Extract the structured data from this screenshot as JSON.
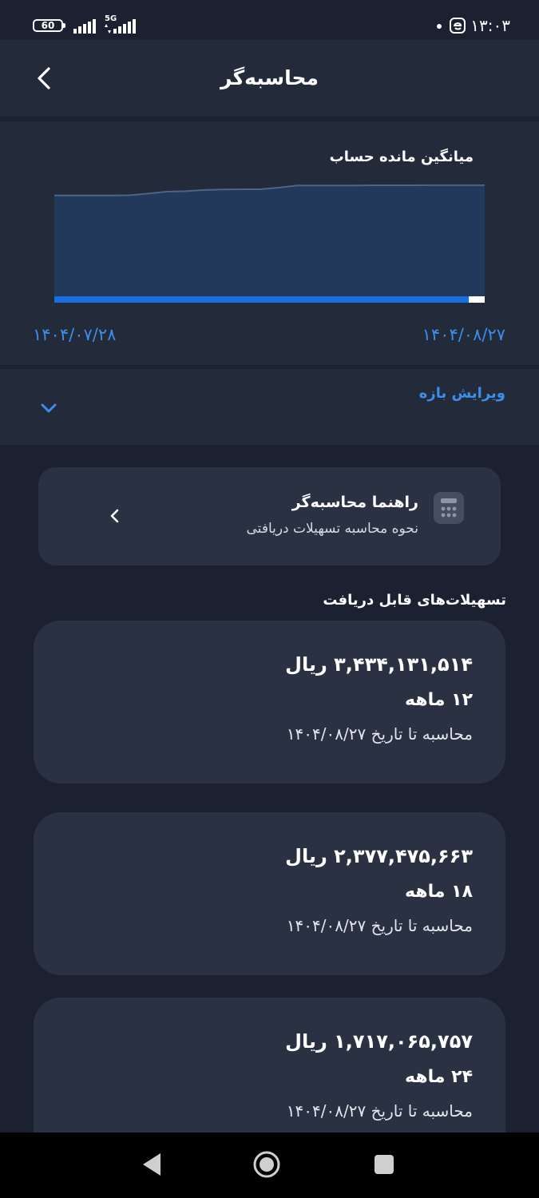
{
  "status_bar": {
    "battery": "60",
    "network": "5G",
    "time": "۱۳:۰۳"
  },
  "header": {
    "title": "محاسبه‌گر",
    "back_icon": "chevron-left-icon"
  },
  "balance_chart": {
    "title": "میانگین مانده حساب",
    "date_start": "۱۴۰۴/۰۷/۲۸",
    "date_end": "۱۴۰۴/۰۸/۲۷",
    "fill_color": "#23395b",
    "line_color": "#4f6384",
    "bar_color": "#1a6fe0",
    "progress_fraction": 0.963
  },
  "chart_data": {
    "type": "area",
    "title": "میانگین مانده حساب",
    "x_start": "۱۴۰۴/۰۷/۲۸",
    "x_end": "۱۴۰۴/۰۸/۲۷",
    "y_axis_labels": "none",
    "relative_values": [
      0.848,
      0.848,
      0.848,
      0.849,
      0.85,
      0.864,
      0.88,
      0.884,
      0.894,
      0.899,
      0.9,
      0.9,
      0.914,
      0.932,
      0.932,
      0.932,
      0.932,
      0.933,
      0.933,
      0.933,
      0.934,
      0.934,
      0.934,
      0.934
    ]
  },
  "range": {
    "label": "ویرایش بازه",
    "icon": "chevron-down-icon"
  },
  "guide": {
    "title": "راهنما محاسبه‌گر",
    "subtitle": "نحوه محاسبه تسهیلات دریافتی",
    "icon": "calculator-icon",
    "chevron": "chevron-left-icon"
  },
  "facilities": {
    "heading": "تسهیلات‌های قابل دریافت",
    "items": [
      {
        "amount": "۳,۴۳۴,۱۳۱,۵۱۴ ریال",
        "term": "۱۲ ماهه",
        "calc_date": "محاسبه تا تاریخ ۱۴۰۴/۰۸/۲۷"
      },
      {
        "amount": "۲,۳۷۷,۴۷۵,۶۶۳ ریال",
        "term": "۱۸ ماهه",
        "calc_date": "محاسبه تا تاریخ ۱۴۰۴/۰۸/۲۷"
      },
      {
        "amount": "۱,۷۱۷,۰۶۵,۷۵۷ ریال",
        "term": "۲۴ ماهه",
        "calc_date": "محاسبه تا تاریخ ۱۴۰۴/۰۸/۲۷"
      }
    ]
  },
  "nav_bar": {
    "back_icon": "triangle-back-icon",
    "home_icon": "circle-home-icon",
    "recent_icon": "square-recent-icon"
  }
}
